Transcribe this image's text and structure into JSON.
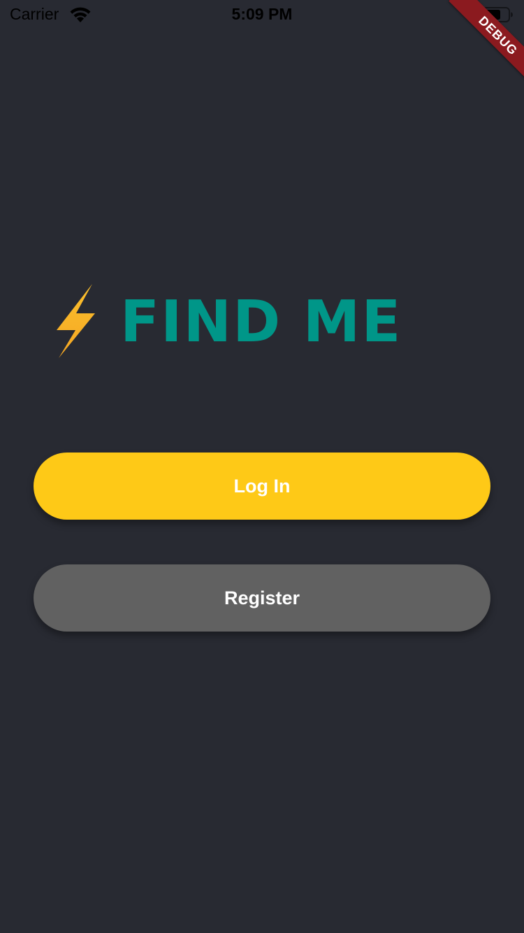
{
  "status_bar": {
    "carrier": "Carrier",
    "time": "5:09 PM",
    "wifi_icon": "wifi-icon",
    "battery_icon": "battery-icon"
  },
  "debug_banner": {
    "label": "DEBUG"
  },
  "logo": {
    "icon": "lightning-bolt-icon",
    "title": "FIND ME"
  },
  "actions": {
    "login_label": "Log In",
    "register_label": "Register"
  },
  "colors": {
    "background": "#282a32",
    "title": "#009688",
    "login_button": "#fec917",
    "register_button": "#616161",
    "bolt": "#f8b624",
    "debug_banner": "#8b1a1f"
  }
}
